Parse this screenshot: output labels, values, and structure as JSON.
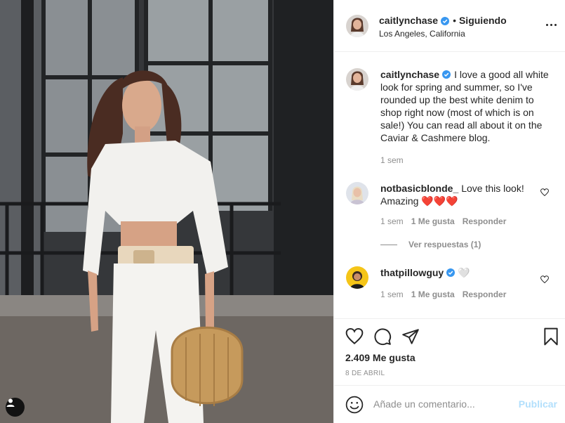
{
  "colors": {
    "text": "#262626",
    "secondary_text": "#8e8e8e",
    "border": "#efefef",
    "verified": "#3897f0",
    "heart_red": "#ed4956",
    "publish_disabled": "#b2dffc"
  },
  "photo": {
    "tag_icon": "user-tag-icon"
  },
  "header": {
    "username": "caitlynchase",
    "separator": "•",
    "follow_status": "Siguiendo",
    "location": "Los Angeles, California",
    "more_icon": "ellipsis-icon"
  },
  "caption": {
    "username": "caitlynchase",
    "text": "I love a good all white look for spring and summer, so I've rounded up the best white denim to shop right now (most of which is on sale!) You can read all about it on the Caviar & Cashmere blog.",
    "time": "1 sem"
  },
  "comments": [
    {
      "username": "notbasicblonde_",
      "text": "Love this look! Amazing",
      "emoji": "❤️❤️❤️",
      "time": "1 sem",
      "likes": "1 Me gusta",
      "reply": "Responder",
      "view_replies": "Ver respuestas (1)"
    },
    {
      "username": "thatpillowguy",
      "text": "🤍",
      "time": "1 sem",
      "likes": "1 Me gusta",
      "reply": "Responder"
    }
  ],
  "actions": {
    "like_icon": "heart-icon",
    "comment_icon": "comment-icon",
    "share_icon": "paper-plane-icon",
    "save_icon": "bookmark-icon",
    "likes_count": "2.409 Me gusta",
    "date": "8 DE ABRIL"
  },
  "add_comment": {
    "emoji_icon": "emoji-icon",
    "placeholder": "Añade un comentario...",
    "publish_label": "Publicar"
  }
}
